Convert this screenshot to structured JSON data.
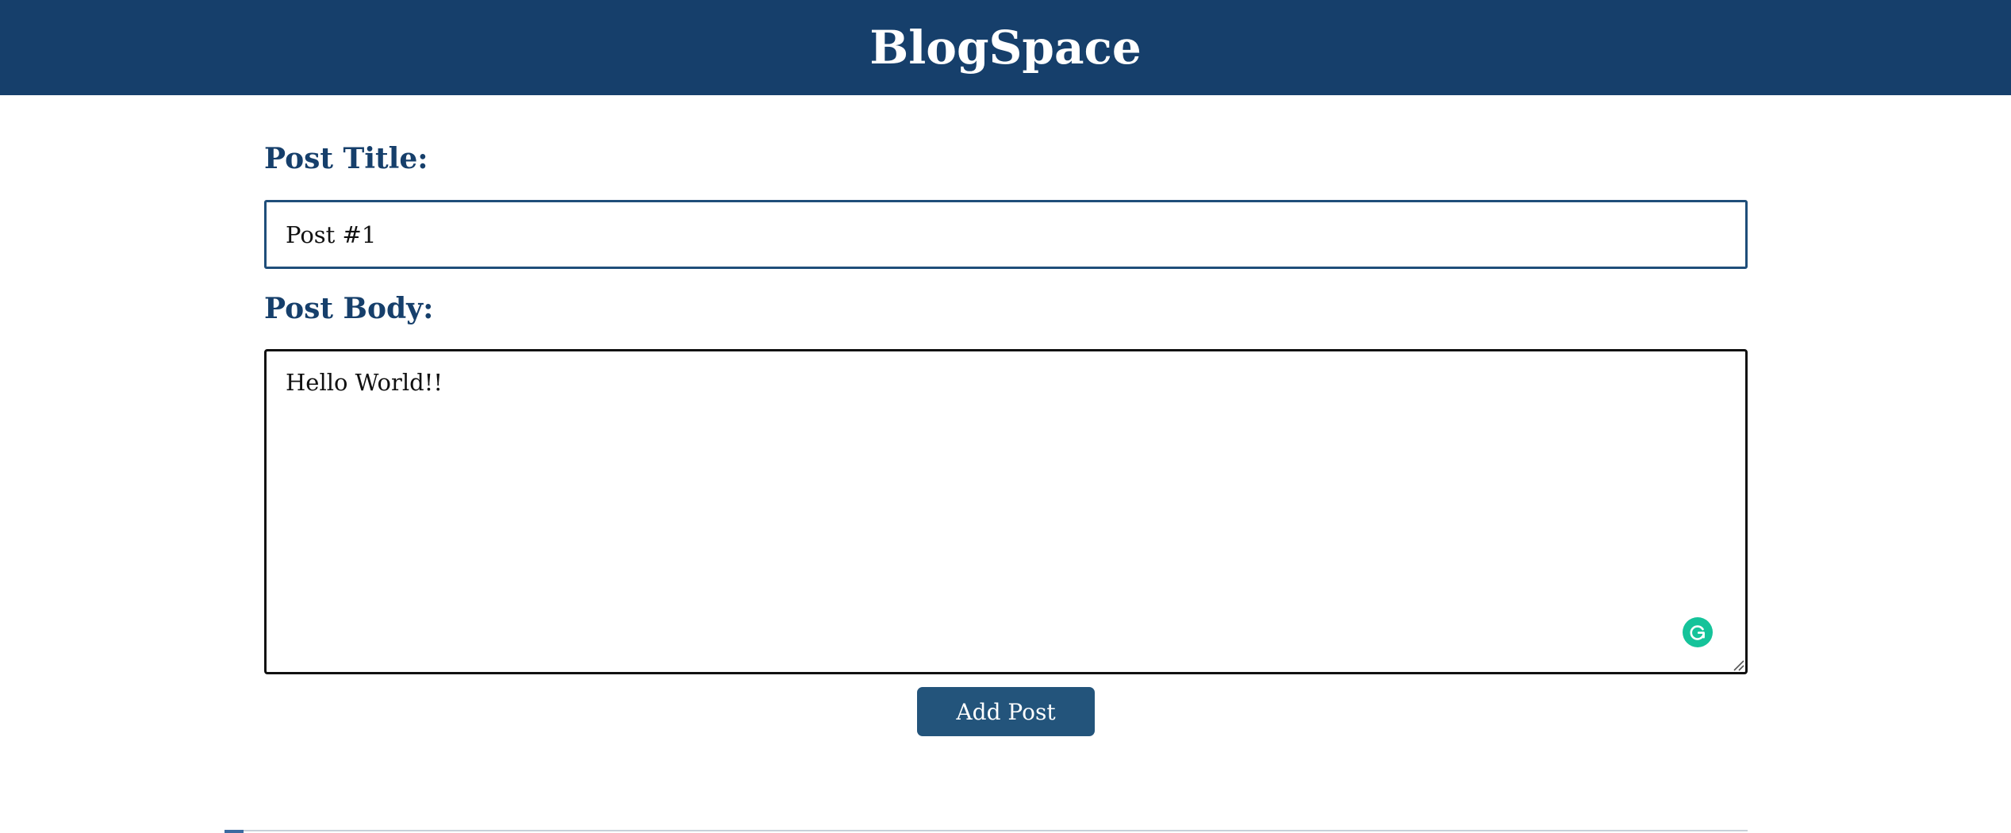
{
  "header": {
    "title": "BlogSpace"
  },
  "form": {
    "title_label": "Post Title:",
    "title_value": "Post #1",
    "body_label": "Post Body:",
    "body_value": "Hello World!!",
    "submit_label": "Add Post"
  },
  "icons": {
    "grammarly": "grammarly-icon",
    "resize": "resize-handle-icon"
  },
  "colors": {
    "header_bg": "#163f6b",
    "accent_text": "#163f6b",
    "button_bg": "#23547b",
    "grammarly_green": "#15c39a"
  }
}
